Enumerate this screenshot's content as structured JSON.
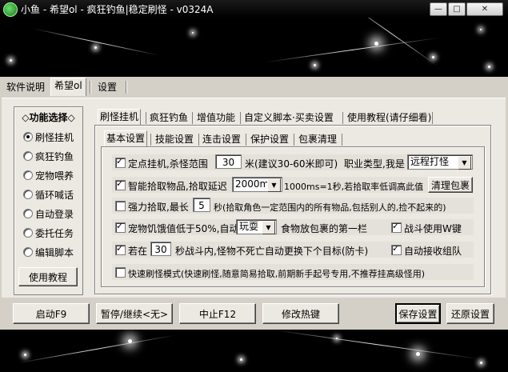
{
  "window": {
    "title": "小鱼 - 希望ol - 疯狂钓鱼|稳定刷怪 - v0324A",
    "minimize": "—",
    "maximize": "□",
    "close": "✕"
  },
  "top_tabs": [
    "软件说明",
    "希望ol",
    "设置"
  ],
  "left_panel": {
    "title": "◇功能选择◇",
    "items": [
      {
        "label": "刷怪挂机",
        "checked": true
      },
      {
        "label": "疯狂钓鱼",
        "checked": false
      },
      {
        "label": "宠物喂养",
        "checked": false
      },
      {
        "label": "循环喊话",
        "checked": false
      },
      {
        "label": "自动登录",
        "checked": false
      },
      {
        "label": "委托任务",
        "checked": false
      },
      {
        "label": "编辑脚本",
        "checked": false
      }
    ],
    "button": "使用教程"
  },
  "main_tabs": [
    "刷怪挂机",
    "疯狂钓鱼",
    "增值功能",
    "自定义脚本·买卖设置",
    "使用教程(请仔细看)"
  ],
  "sub_tabs": [
    "基本设置",
    "技能设置",
    "连击设置",
    "保护设置",
    "包裹清理"
  ],
  "settings": {
    "row1": {
      "checked": true,
      "label": "定点挂机,杀怪范围",
      "value": "30",
      "suffix": "米(建议30-60米即可)",
      "job_label": "职业类型,我是",
      "job_value": "远程打怪"
    },
    "row2": {
      "checked": true,
      "label": "智能拾取物品,拾取延迟",
      "delay_value": "2000ms",
      "suffix": "1000ms=1秒,若拾取率低调高此值",
      "button": "清理包裹"
    },
    "row3": {
      "checked": false,
      "label": "强力拾取,最长",
      "value": "5",
      "suffix": "秒(拾取角色一定范围内的所有物品,包括别人的,捡不起来的)"
    },
    "row4": {
      "checked": true,
      "label": "宠物饥饿值低于50%,自动",
      "combo_value": "玩耍",
      "suffix": "食物放包裹的第一栏",
      "side_checked": true,
      "side_label": "战斗使用W键"
    },
    "row5": {
      "checked": true,
      "prefix": "若在",
      "value": "30",
      "suffix": "秒战斗内,怪物不死亡自动更换下个目标(防卡)",
      "side_checked": true,
      "side_label": "自动接收组队"
    },
    "row6": {
      "checked": false,
      "label": "快速刷怪模式(快速刷怪,随意简易拾取,前期新手起号专用,不推荐挂高级怪用)"
    }
  },
  "bottom_buttons": {
    "start": "启动F9",
    "pause": "暂停/继续<无>",
    "stop": "中止F12",
    "hotkey": "修改热键",
    "save": "保存设置",
    "restore": "还原设置"
  }
}
